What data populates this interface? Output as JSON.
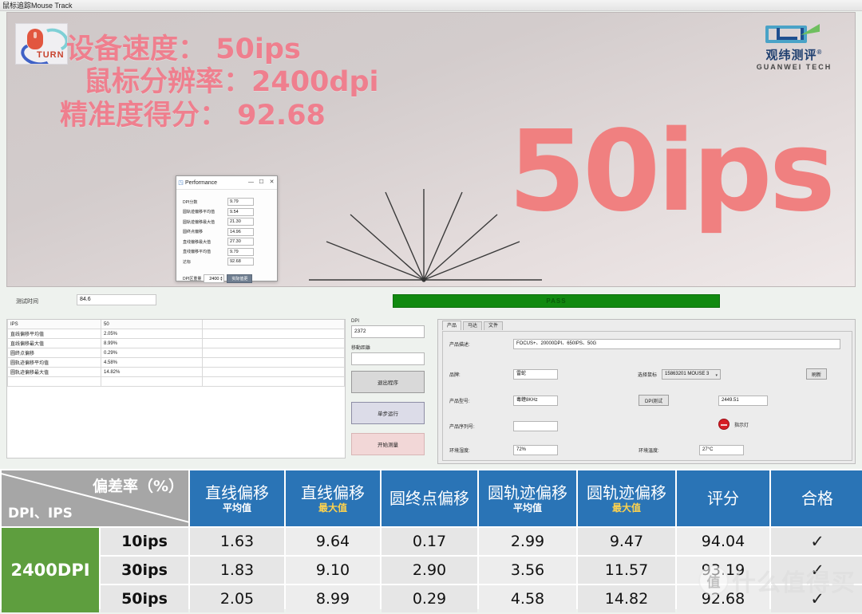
{
  "window": {
    "title": "鼠标追踪Mouse Track"
  },
  "hero": {
    "logo_word": "TURN",
    "line1": "设备速度：  50ips",
    "line2": "鼠标分辨率：2400dpi",
    "line3": "精准度得分： 92.68",
    "big_text": "50ips",
    "brand": {
      "cn": "观纬测评",
      "reg": "®",
      "en": "GUANWEI TECH"
    }
  },
  "perf_dialog": {
    "title": "Performance",
    "icon": "app-icon",
    "minimize": "—",
    "maximize": "☐",
    "close": "✕",
    "rows": [
      {
        "label": "DPI分数",
        "value": "9.79"
      },
      {
        "label": "圆轨迹偏移平均值",
        "value": "9.54"
      },
      {
        "label": "圆轨迹偏移最大值",
        "value": "21.30"
      },
      {
        "label": "圆终点偏移",
        "value": "14.96"
      },
      {
        "label": "直线偏移最大值",
        "value": "27.30"
      },
      {
        "label": "直线偏移平均值",
        "value": "9.79"
      },
      {
        "label": "达标",
        "value": "92.68"
      }
    ],
    "footer_label": "DPI区重量",
    "spinner_value": "2400",
    "action_label": "实际值更"
  },
  "strip": {
    "test_time_label": "测试时间",
    "test_time_value": "84.6",
    "pass_text": "PASS"
  },
  "results_pane": {
    "rows": [
      {
        "k": "IPS",
        "v": "50"
      },
      {
        "k": "直线偏移平均值",
        "v": "2.05%"
      },
      {
        "k": "直线偏移最大值",
        "v": "8.99%"
      },
      {
        "k": "圆终点偏移",
        "v": "0.29%"
      },
      {
        "k": "圆轨迹偏移平均值",
        "v": "4.58%"
      },
      {
        "k": "圆轨迹偏移最大值",
        "v": "14.82%"
      },
      {
        "k": "",
        "v": ""
      }
    ]
  },
  "control_pane": {
    "dpi_label": "DPI",
    "dpi_value": "2372",
    "distance_label": "移動距離",
    "distance_value": "",
    "exit_button": "退出程序",
    "step_button": "单步运行",
    "start_button": "开始测量"
  },
  "product_pane": {
    "tabs": [
      {
        "label": "产品",
        "active": true
      },
      {
        "label": "马达",
        "active": false
      },
      {
        "label": "文件",
        "active": false
      }
    ],
    "desc_label": "产品描述:",
    "desc_value": "FOCUS+、20000DPI、650IPS、50G",
    "brand_label": "品牌:",
    "brand_value": "雷蛇",
    "mouse_select_label": "选择鼠标",
    "mouse_select_value": "15863201  MOUSE 3",
    "refresh_button": "刷新",
    "model_label": "产品型号:",
    "model_value": "毒蝰8KHz",
    "dpi_test_button": "DPI测试",
    "dpi_test_value": "2449.51",
    "serial_label": "产品序列号:",
    "serial_value": "",
    "led_label": "指示灯",
    "humidity_label": "环境湿度:",
    "humidity_value": "72%",
    "temperature_label": "环境温度:",
    "temperature_value": "27°C"
  },
  "big_table": {
    "corner_top": "偏差率（%）",
    "corner_bottom": "DPI、IPS",
    "dpi_group": "2400DPI",
    "headers": [
      {
        "main": "直线偏移",
        "sub": "平均值",
        "sub_gold": false
      },
      {
        "main": "直线偏移",
        "sub": "最大值",
        "sub_gold": true
      },
      {
        "main": "圆终点偏移",
        "sub": "",
        "sub_gold": false
      },
      {
        "main": "圆轨迹偏移",
        "sub": "平均值",
        "sub_gold": false
      },
      {
        "main": "圆轨迹偏移",
        "sub": "最大值",
        "sub_gold": true
      },
      {
        "main": "评分",
        "sub": "",
        "sub_gold": false
      },
      {
        "main": "合格",
        "sub": "",
        "sub_gold": false
      }
    ],
    "rows": [
      {
        "ips": "10ips",
        "line_avg": "1.63",
        "line_max": "9.64",
        "circle_end": "0.17",
        "arc_avg": "2.99",
        "arc_max": "9.47",
        "score": "94.04",
        "pass": "✓"
      },
      {
        "ips": "30ips",
        "line_avg": "1.83",
        "line_max": "9.10",
        "circle_end": "2.90",
        "arc_avg": "3.56",
        "arc_max": "11.57",
        "score": "93.19",
        "pass": "✓"
      },
      {
        "ips": "50ips",
        "line_avg": "2.05",
        "line_max": "8.99",
        "circle_end": "0.29",
        "arc_avg": "4.58",
        "arc_max": "14.82",
        "score": "92.68",
        "pass": "✓"
      }
    ]
  },
  "watermark": {
    "mark": "值",
    "text": "什么值得买"
  },
  "chart_data": {
    "type": "table",
    "title": "2400DPI 偏差率（%）",
    "categories": [
      "10ips",
      "30ips",
      "50ips"
    ],
    "series": [
      {
        "name": "直线偏移平均值",
        "values": [
          1.63,
          1.83,
          2.05
        ]
      },
      {
        "name": "直线偏移最大值",
        "values": [
          9.64,
          9.1,
          8.99
        ]
      },
      {
        "name": "圆终点偏移",
        "values": [
          0.17,
          2.9,
          0.29
        ]
      },
      {
        "name": "圆轨迹偏移平均值",
        "values": [
          2.99,
          3.56,
          4.58
        ]
      },
      {
        "name": "圆轨迹偏移最大值",
        "values": [
          9.47,
          11.57,
          14.82
        ]
      },
      {
        "name": "评分",
        "values": [
          94.04,
          93.19,
          92.68
        ]
      }
    ]
  }
}
